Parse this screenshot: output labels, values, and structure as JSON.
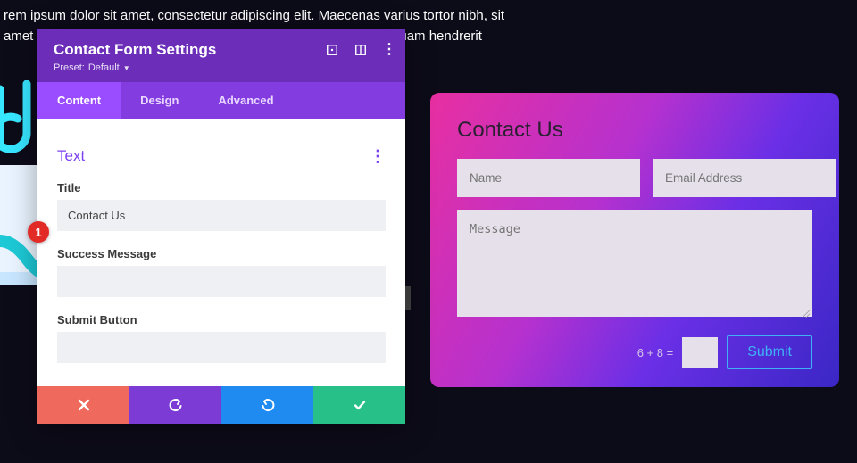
{
  "background_text": {
    "line1": "rem ipsum dolor sit amet, consectetur adipiscing elit. Maecenas varius tortor nibh, sit",
    "line2_left": "amet",
    "line2_right": "uam hendrerit"
  },
  "panel": {
    "title": "Contact Form Settings",
    "preset_prefix": "Preset:",
    "preset_value": "Default",
    "tabs": {
      "content": "Content",
      "design": "Design",
      "advanced": "Advanced"
    },
    "section_text": "Text",
    "fields": {
      "title_label": "Title",
      "title_value": "Contact Us",
      "success_label": "Success Message",
      "success_value": "",
      "submit_label": "Submit Button",
      "submit_value": ""
    }
  },
  "badge": {
    "number": "1"
  },
  "preview": {
    "heading": "Contact Us",
    "name_placeholder": "Name",
    "email_placeholder": "Email Address",
    "message_placeholder": "Message",
    "captcha_label": "6 + 8 =",
    "submit_label": "Submit"
  }
}
